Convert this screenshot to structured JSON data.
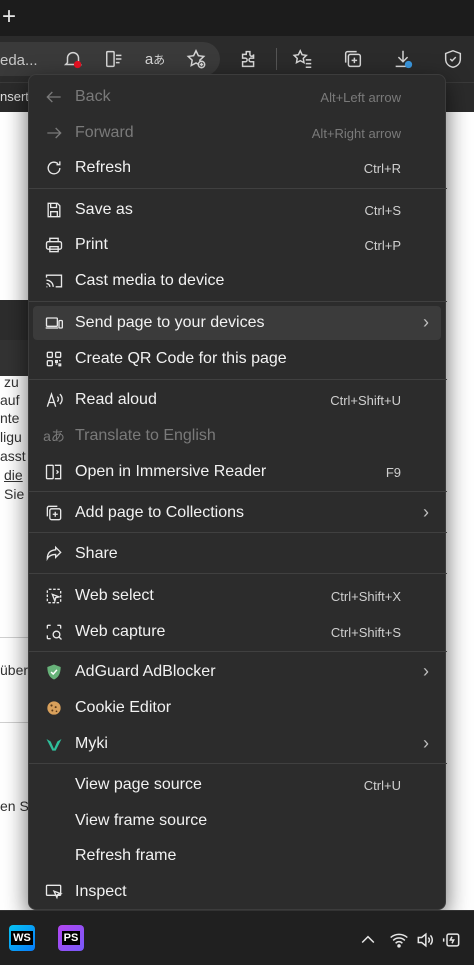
{
  "toolbar": {
    "address_text": "eda...",
    "icons": [
      "notifications-blocked-icon",
      "immersive-reader-icon",
      "read-aloud-translate-icon",
      "add-favorite-icon",
      "extensions-icon",
      "favorites-icon",
      "collections-icon",
      "downloads-icon",
      "browser-essentials-icon"
    ]
  },
  "favorites_bar": {
    "text": "nsert"
  },
  "page_fragments": [
    "zu",
    "auf",
    "nte",
    "ligu",
    "asst",
    "die",
    "Sie",
    "über",
    "en S"
  ],
  "menu": {
    "items": [
      {
        "label": "Back",
        "shortcut": "Alt+Left arrow",
        "icon": "back-arrow-icon",
        "disabled": true
      },
      {
        "label": "Forward",
        "shortcut": "Alt+Right arrow",
        "icon": "forward-arrow-icon",
        "disabled": true
      },
      {
        "label": "Refresh",
        "shortcut": "Ctrl+R",
        "icon": "refresh-icon"
      },
      {
        "label": "Save as",
        "shortcut": "Ctrl+S",
        "icon": "save-icon"
      },
      {
        "label": "Print",
        "shortcut": "Ctrl+P",
        "icon": "print-icon"
      },
      {
        "label": "Cast media to device",
        "shortcut": "",
        "icon": "cast-icon"
      },
      {
        "label": "Send page to your devices",
        "shortcut": "",
        "icon": "devices-icon",
        "submenu": true
      },
      {
        "label": "Create QR Code for this page",
        "shortcut": "",
        "icon": "qr-code-icon"
      },
      {
        "label": "Read aloud",
        "shortcut": "Ctrl+Shift+U",
        "icon": "read-aloud-icon"
      },
      {
        "label": "Translate to English",
        "shortcut": "",
        "icon": "translate-icon",
        "disabled": true
      },
      {
        "label": "Open in Immersive Reader",
        "shortcut": "F9",
        "icon": "immersive-reader-icon"
      },
      {
        "label": "Add page to Collections",
        "shortcut": "",
        "icon": "collections-icon",
        "submenu": true
      },
      {
        "label": "Share",
        "shortcut": "",
        "icon": "share-icon"
      },
      {
        "label": "Web select",
        "shortcut": "Ctrl+Shift+X",
        "icon": "web-select-icon"
      },
      {
        "label": "Web capture",
        "shortcut": "Ctrl+Shift+S",
        "icon": "web-capture-icon"
      },
      {
        "label": "AdGuard AdBlocker",
        "shortcut": "",
        "icon": "adguard-shield-icon",
        "submenu": true
      },
      {
        "label": "Cookie Editor",
        "shortcut": "",
        "icon": "cookie-icon"
      },
      {
        "label": "Myki",
        "shortcut": "",
        "icon": "myki-icon",
        "submenu": true
      },
      {
        "label": "View page source",
        "shortcut": "Ctrl+U",
        "icon": ""
      },
      {
        "label": "View frame source",
        "shortcut": "",
        "icon": ""
      },
      {
        "label": "Refresh frame",
        "shortcut": "",
        "icon": ""
      },
      {
        "label": "Inspect",
        "shortcut": "",
        "icon": "inspect-icon"
      }
    ]
  },
  "taskbar": {
    "apps": [
      {
        "label": "WS",
        "icon": "webstorm-icon"
      },
      {
        "label": "PS",
        "icon": "phpstorm-icon"
      }
    ],
    "tray_icons": [
      "chevron-up-icon",
      "wifi-icon",
      "volume-icon",
      "battery-icon"
    ]
  },
  "colors": {
    "menu_bg": "#2c2c2c",
    "hover_bg": "#3b3b3b",
    "adguard_green": "#67b279",
    "myki_teal": "#2fbf9b",
    "download_badge": "#3a96dd",
    "notif_badge": "#e81123"
  }
}
